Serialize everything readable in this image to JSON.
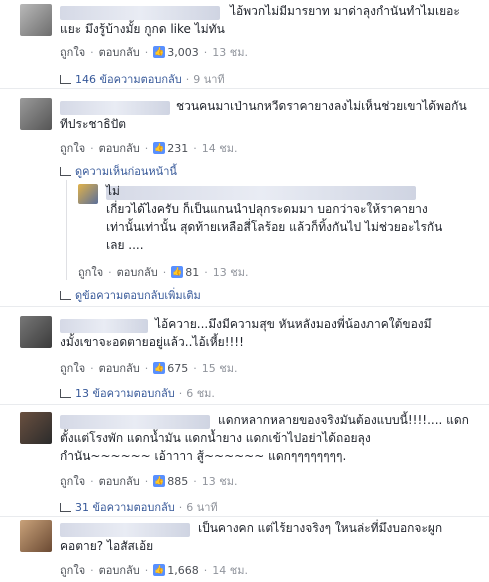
{
  "comments": [
    {
      "text": "ไอ้พวกไม่มีมารยาท มาด่าลุงกำนันทำไมเยอะ\nแยะ มึงรู้บ้างมั้ย กูกด like ไม่ทัน",
      "like": "ถูกใจ",
      "reply": "ตอบกลับ",
      "likes": "3,003",
      "time": "13 ชม.",
      "replies_link": "146 ข้อความตอบกลับ",
      "replies_time": "9 นาที"
    },
    {
      "text": "ชวนคนมาเป่านกหวีดราคายางลงไม่เห็นช่วยเขาได้พอกัน\nทีประชาธิปัต",
      "like": "ถูกใจ",
      "reply": "ตอบกลับ",
      "likes": "231",
      "time": "14 ชม.",
      "prev_link": "ดูความเห็นก่อนหน้านี้",
      "nested": {
        "text": "ไม่\nเกี่ยวได้ไงครับ ก็เป็นแกนนำปลุกระดมมา บอกว่าจะให้ราคายาง\nเท่านั้นเท่านั้น สุดท้ายเหลือสี่โลร้อย แล้วก็ทิ้งกันไป ไม่ช่วยอะไรกัน\nเลย ....",
        "like": "ถูกใจ",
        "reply": "ตอบกลับ",
        "likes": "81",
        "time": "13 ชม."
      },
      "more_replies": "ดูข้อความตอบกลับเพิ่มเติม"
    },
    {
      "text": "ไอ้ควาย...มึงมีความสุข หันหลังมองพี่น้องภาคใต้ของมึ\nงมั้งเขาจะอดตายอยู่แล้ว..ไอ้เหี้ย!!!!",
      "like": "ถูกใจ",
      "reply": "ตอบกลับ",
      "likes": "675",
      "time": "15 ชม.",
      "replies_link": "13 ข้อความตอบกลับ",
      "replies_time": "6 ชม."
    },
    {
      "text": "แดกหลากหลายของจริงมันต้องแบบนี้!!!!.... แดก\nตั้งแต่โรงพัก แดกน้ำมัน แดกน้ำยาง แดกเข้าไปอย่าได้ถอยลุง\nกำนัน~~~~~~ เอ้าาาา สู้~~~~~~ แดกๆๆๆๆๆๆๆๆ.",
      "like": "ถูกใจ",
      "reply": "ตอบกลับ",
      "likes": "885",
      "time": "13 ชม.",
      "replies_link": "31 ข้อความตอบกลับ",
      "replies_time": "6 นาที"
    },
    {
      "text": "เป็นคางคก แต่ไร้ยางจริงๆ ใหนล่ะที่มึงบอกจะผูก\nคอตาย? ไอสัสเอ้ย",
      "like": "ถูกใจ",
      "reply": "ตอบกลับ",
      "likes": "1,668",
      "time": "14 ชม."
    }
  ],
  "colors": {
    "link": "#365899",
    "meta": "#90949c",
    "like_badge": "#5890ff"
  }
}
